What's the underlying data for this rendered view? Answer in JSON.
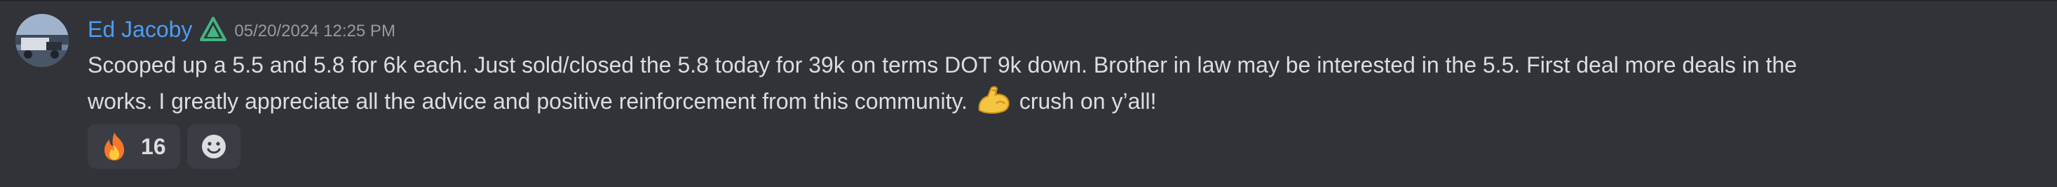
{
  "message": {
    "author": "Ed Jacoby",
    "role_icon": "warning-triangle-icon",
    "timestamp": "05/20/2024 12:25 PM",
    "line_1": "Scooped up a 5.5 and 5.8 for 6k each. Just sold/closed the 5.8 today for 39k on terms DOT 9k down. Brother in law may be interested in the 5.5. First deal more deals in the",
    "line_2_before_emoji": "works. I greatly appreciate all the advice and positive reinforcement from this community.",
    "inline_emoji": "flexed-biceps-emoji",
    "line_2_after_emoji": "crush on y’all!"
  },
  "reactions": [
    {
      "emoji": "fire-emoji",
      "count": "16"
    }
  ],
  "add_reaction_icon": "smiley-add-reaction-icon",
  "colors": {
    "background": "#313338",
    "username": "#4f9cf2",
    "text": "#dbdee1",
    "timestamp": "#949ba4",
    "reaction_bg": "#3b3d44",
    "role_icon": "#43b581"
  }
}
